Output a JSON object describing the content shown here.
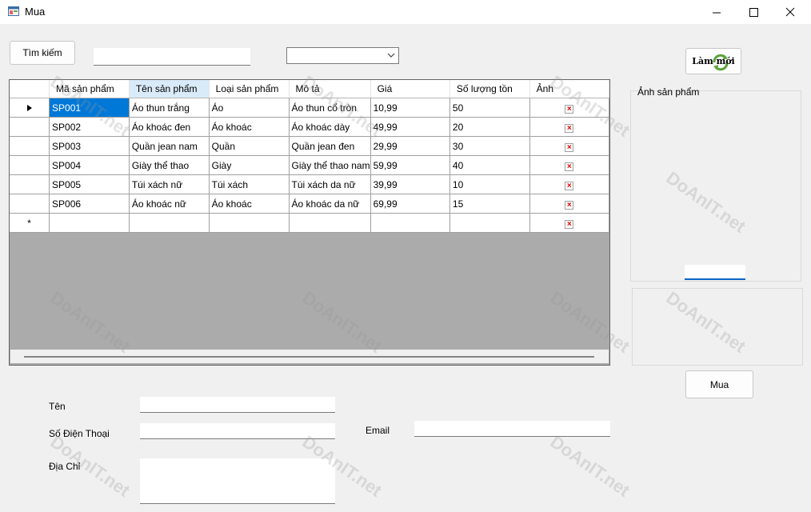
{
  "window": {
    "title": "Mua",
    "controls": [
      "minimize",
      "maximize",
      "close"
    ]
  },
  "search": {
    "button_label": "Tìm kiếm",
    "input_value": "",
    "combo_value": ""
  },
  "refresh": {
    "button_label": "Làm mới",
    "icon": "refresh-arrows-icon"
  },
  "grid": {
    "columns": [
      "Mã sản phẩm",
      "Tên sản phẩm",
      "Loại sản phẩm",
      "Mô tả",
      "Giá",
      "Số lượng tồn",
      "Ảnh"
    ],
    "rows": [
      [
        "SP001",
        "Áo thun trắng",
        "Áo",
        "Áo thun cổ tròn",
        "10,99",
        "50"
      ],
      [
        "SP002",
        "Áo khoác đen",
        "Áo khoác",
        "Áo khoác dày",
        "49,99",
        "20"
      ],
      [
        "SP003",
        "Quần jean nam",
        "Quần",
        "Quần jean đen",
        "29,99",
        "30"
      ],
      [
        "SP004",
        "Giày thể thao",
        "Giày",
        "Giày thể thao nam",
        "59,99",
        "40"
      ],
      [
        "SP005",
        "Túi xách nữ",
        "Túi xách",
        "Túi xách da nữ",
        "39,99",
        "10"
      ],
      [
        "SP006",
        "Áo khoác nữ",
        "Áo khoác",
        "Áo khoác da nữ",
        "69,99",
        "15"
      ]
    ],
    "new_row_marker": "*"
  },
  "image_panel": {
    "label": "Ảnh sản phẩm"
  },
  "buy": {
    "button_label": "Mua"
  },
  "form": {
    "name_label": "Tên",
    "name_value": "",
    "phone_label": "Số Điện Thoại",
    "phone_value": "",
    "address_label": "Địa Chỉ",
    "address_value": "",
    "email_label": "Email",
    "email_value": ""
  },
  "watermark": {
    "text": "DoAnIT.net"
  },
  "colors": {
    "selection": "#0078d7",
    "grid_bg": "#ababab",
    "window_bg": "#f0f0f0"
  }
}
